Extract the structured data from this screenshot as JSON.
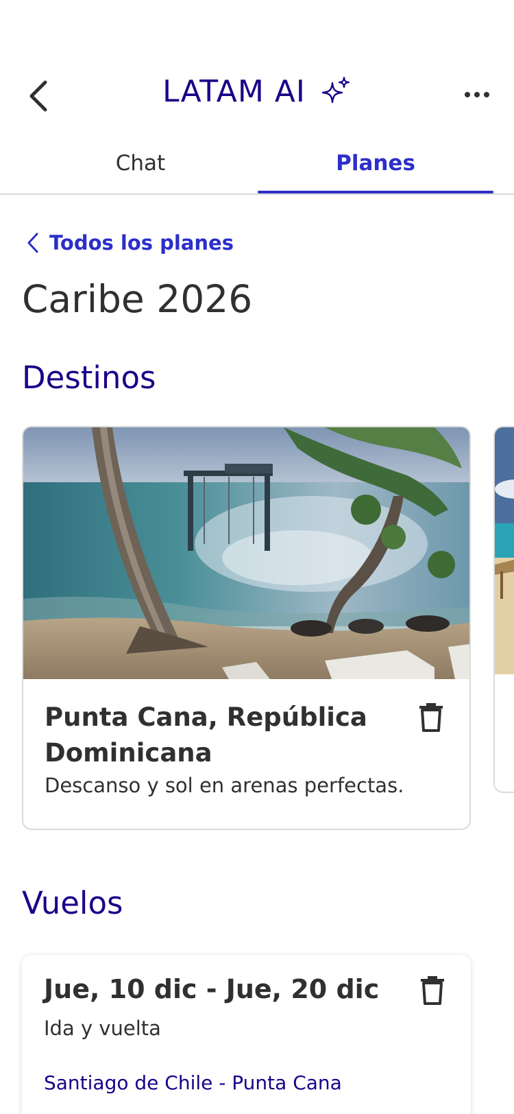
{
  "header": {
    "title": "LATAM AI"
  },
  "tabs": [
    {
      "label": "Chat",
      "active": false
    },
    {
      "label": "Planes",
      "active": true
    }
  ],
  "plan": {
    "back_link": "Todos los planes",
    "title": "Caribe 2026"
  },
  "destinations": {
    "section_title": "Destinos",
    "items": [
      {
        "name": "Punta Cana, República Dominicana",
        "description": "Descanso y sol en arenas perfectas."
      }
    ]
  },
  "flights": {
    "section_title": "Vuelos",
    "items": [
      {
        "dates": "Jue, 10 dic - Jue, 20 dic",
        "trip_type": "Ida y vuelta",
        "route": "Santiago de Chile - Punta Cana"
      }
    ]
  },
  "colors": {
    "brand": "#1b0088",
    "accent": "#2c2fc9",
    "text": "#303030",
    "border": "#dadada"
  },
  "icons": [
    "back-arrow-icon",
    "sparkle-icon",
    "more-options-icon",
    "chevron-left-icon",
    "trash-icon"
  ]
}
